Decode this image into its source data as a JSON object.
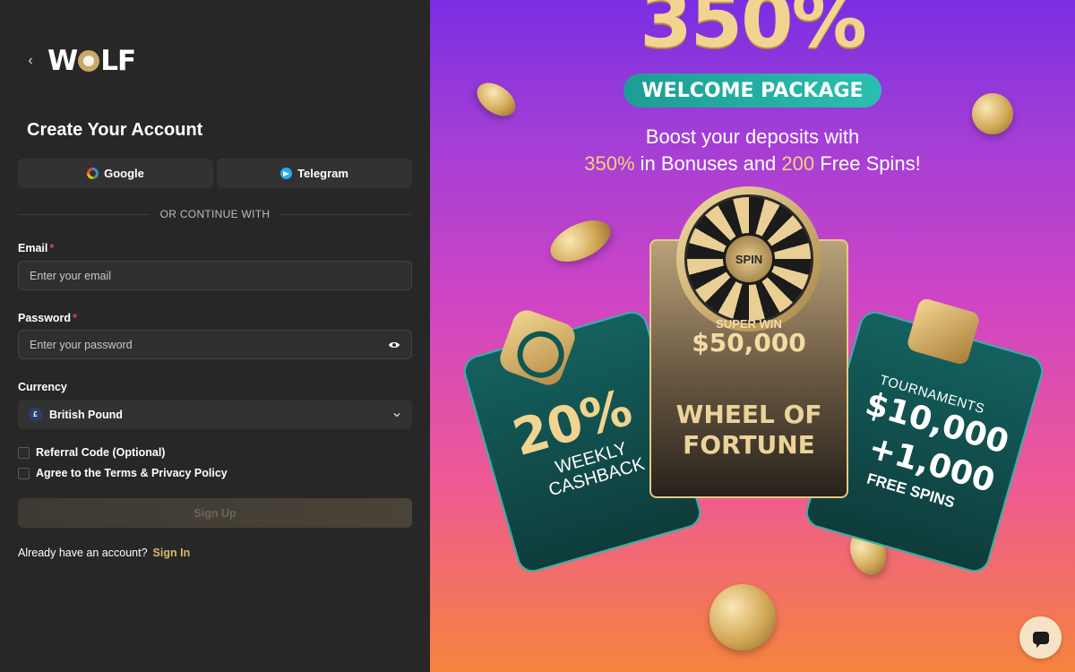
{
  "header": {
    "back_label": "‹",
    "logo_text_1": "W",
    "logo_text_2": "LF"
  },
  "form": {
    "title": "Create Your Account",
    "google_label": "Google",
    "telegram_label": "Telegram",
    "divider_text": "OR CONTINUE WITH",
    "email_label": "Email",
    "email_placeholder": "Enter your email",
    "password_label": "Password",
    "password_placeholder": "Enter your password",
    "required_mark": "*",
    "currency_label": "Currency",
    "currency_symbol": "£",
    "currency_value": "British Pound",
    "referral_label": "Referral Code (Optional)",
    "terms_label": "Agree to the Terms & Privacy Policy",
    "signup_label": "Sign Up",
    "already_text": "Already have an account?",
    "signin_label": "Sign In"
  },
  "promo": {
    "headline": "350%",
    "package": "WELCOME PACKAGE",
    "line1": "Boost your deposits with",
    "line2_pct": "350%",
    "line2_mid": " in Bonuses and ",
    "line2_num": "200",
    "line2_end": " Free Spins!",
    "wheel_spin": "SPIN",
    "super_win": "SUPER WIN",
    "win_amount": "$50,000",
    "wheel_title_1": "WHEEL OF",
    "wheel_title_2": "FORTUNE",
    "cashback_pct": "20%",
    "cashback_1": "WEEKLY",
    "cashback_2": "CASHBACK",
    "tourn_title": "TOURNAMENTS",
    "tourn_prize": "$10,000",
    "tourn_plus": "+1,000",
    "tourn_spins": "FREE SPINS"
  },
  "colors": {
    "accent": "#d9b86e",
    "panel": "#272727",
    "teal": "#2bbfb0"
  },
  "icons": {
    "chat": "chat-icon",
    "eye": "eye-icon",
    "google": "google-icon",
    "telegram": "telegram-icon"
  }
}
